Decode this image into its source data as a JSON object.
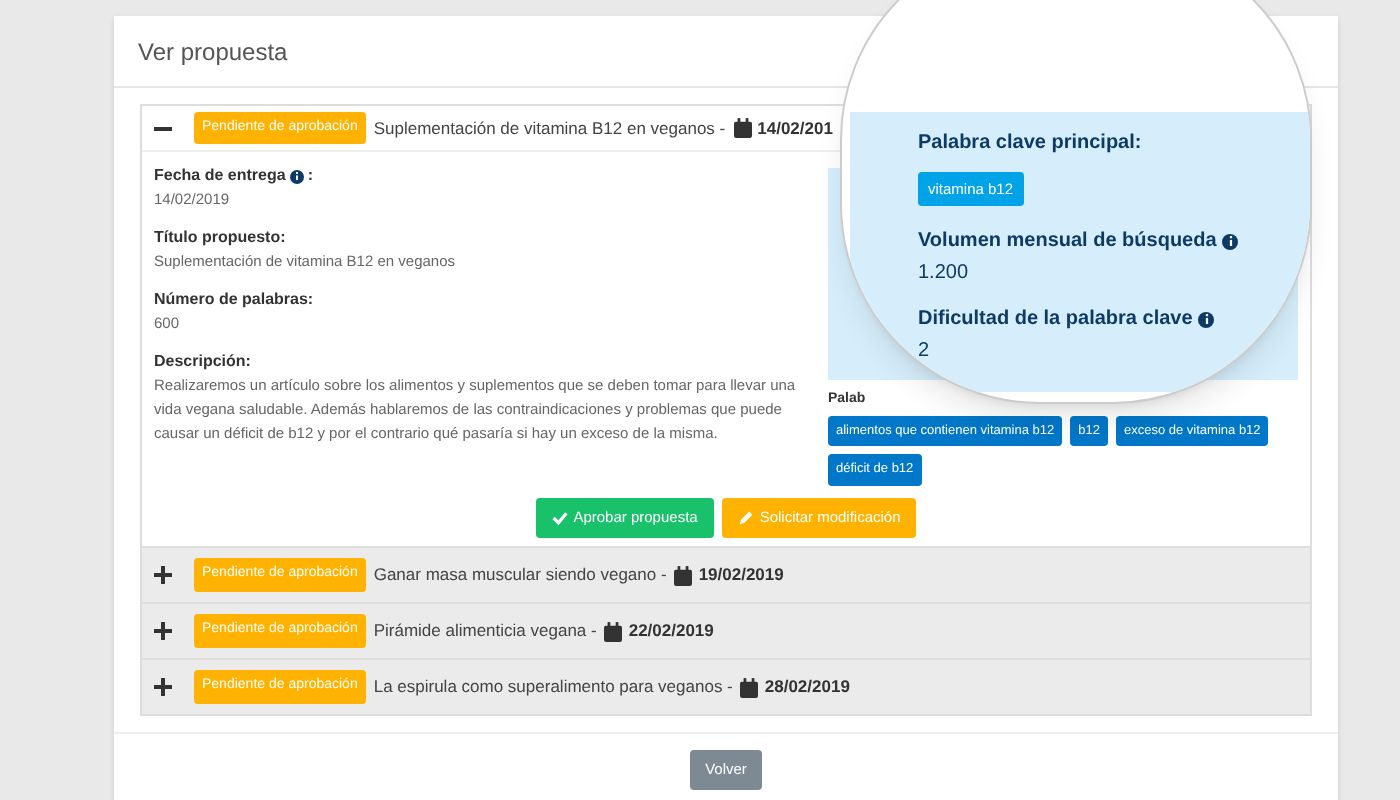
{
  "page": {
    "title": "Ver propuesta"
  },
  "proposals": [
    {
      "expanded": true,
      "status": "Pendiente de aprobación",
      "title": "Suplementación de vitamina B12 en veganos -",
      "date": "14/02/201"
    },
    {
      "expanded": false,
      "status": "Pendiente de aprobación",
      "title": "Ganar masa muscular siendo vegano -",
      "date": "19/02/2019"
    },
    {
      "expanded": false,
      "status": "Pendiente de aprobación",
      "title": "Pirámide alimenticia vegana -",
      "date": "22/02/2019"
    },
    {
      "expanded": false,
      "status": "Pendiente de aprobación",
      "title": "La espirula como superalimento para veganos -",
      "date": "28/02/2019"
    }
  ],
  "detail": {
    "fields": [
      {
        "label": "Fecha de entrega",
        "info": true,
        "suffix": ":",
        "value": "14/02/2019"
      },
      {
        "label": "Título propuesto:",
        "info": false,
        "value": "Suplementación de vitamina B12 en veganos"
      },
      {
        "label": "Número de palabras:",
        "info": false,
        "value": "600"
      },
      {
        "label": "Descripción:",
        "info": false,
        "value": "Realizaremos un artículo sobre los alimentos y suplementos que se deben tomar para llevar una vida vegana saludable. Además hablaremos de las contraindicaciones y problemas que puede causar un déficit de b12 y por el contrario qué pasaría si hay un exceso de la misma."
      }
    ],
    "keyword_panel": {
      "main_label": "Palabra clave principal:",
      "main_keyword": "vitamina b12",
      "stats": [
        {
          "label": "Volumen mensual de búsqueda",
          "value": "1.200"
        },
        {
          "label": "Dificultad de la palabra clave",
          "value": "2"
        }
      ]
    },
    "secondary_label": "Palab",
    "secondary_keywords": [
      "alimentos que contienen vitamina b12",
      "b12",
      "exceso de vitamina b12",
      "déficit de b12"
    ],
    "buttons": [
      {
        "kind": "approve",
        "label": "Aprobar propuesta"
      },
      {
        "kind": "modify",
        "label": "Solicitar modificación"
      }
    ]
  },
  "back_button": "Volver"
}
